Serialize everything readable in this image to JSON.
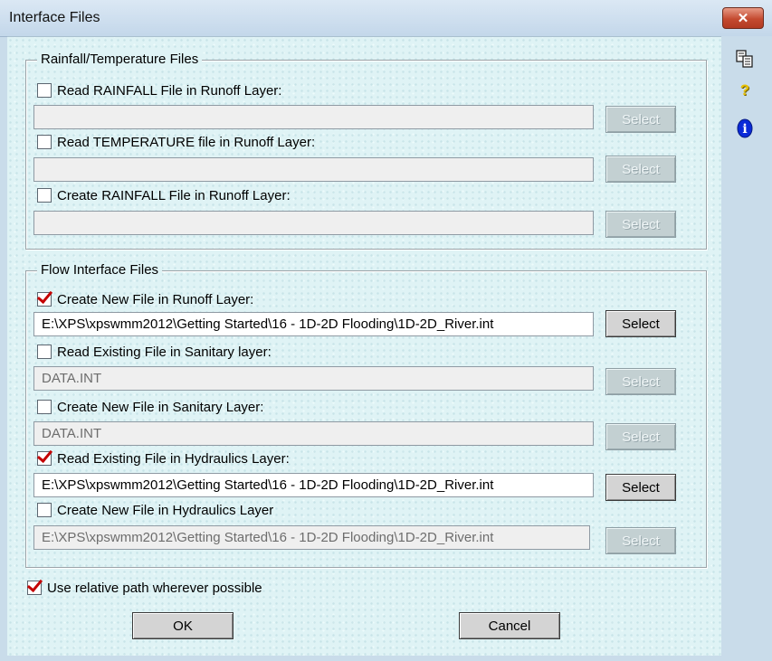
{
  "window": {
    "title": "Interface Files",
    "close_symbol": "✕"
  },
  "sidebar": {
    "icons": [
      "copy-icon",
      "help-question-icon",
      "info-icon"
    ],
    "help_glyph": "?",
    "info_glyph": "i"
  },
  "rainfall_group": {
    "legend": "Rainfall/Temperature Files",
    "rows": [
      {
        "label": "Read RAINFALL File in Runoff Layer:",
        "checked": false,
        "value": "",
        "button": "Select",
        "enabled": false
      },
      {
        "label": "Read TEMPERATURE file in Runoff Layer:",
        "checked": false,
        "value": "",
        "button": "Select",
        "enabled": false
      },
      {
        "label": "Create RAINFALL File in Runoff Layer:",
        "checked": false,
        "value": "",
        "button": "Select",
        "enabled": false
      }
    ]
  },
  "flow_group": {
    "legend": "Flow Interface Files",
    "rows": [
      {
        "label": "Create New File in Runoff Layer:",
        "checked": true,
        "value": "E:\\XPS\\xpswmm2012\\Getting Started\\16 - 1D-2D Flooding\\1D-2D_River.int",
        "button": "Select",
        "enabled": true
      },
      {
        "label": "Read Existing File in Sanitary layer:",
        "checked": false,
        "value": "DATA.INT",
        "button": "Select",
        "enabled": false
      },
      {
        "label": "Create New File in Sanitary Layer:",
        "checked": false,
        "value": "DATA.INT",
        "button": "Select",
        "enabled": false
      },
      {
        "label": "Read Existing File in Hydraulics Layer:",
        "checked": true,
        "value": "E:\\XPS\\xpswmm2012\\Getting Started\\16 - 1D-2D Flooding\\1D-2D_River.int",
        "button": "Select",
        "enabled": true
      },
      {
        "label": "Create New File in Hydraulics Layer",
        "checked": false,
        "value": "E:\\XPS\\xpswmm2012\\Getting Started\\16 - 1D-2D Flooding\\1D-2D_River.int",
        "button": "Select",
        "enabled": false
      }
    ]
  },
  "relative_path": {
    "label": "Use relative path wherever possible",
    "checked": true
  },
  "footer": {
    "ok": "OK",
    "cancel": "Cancel"
  }
}
